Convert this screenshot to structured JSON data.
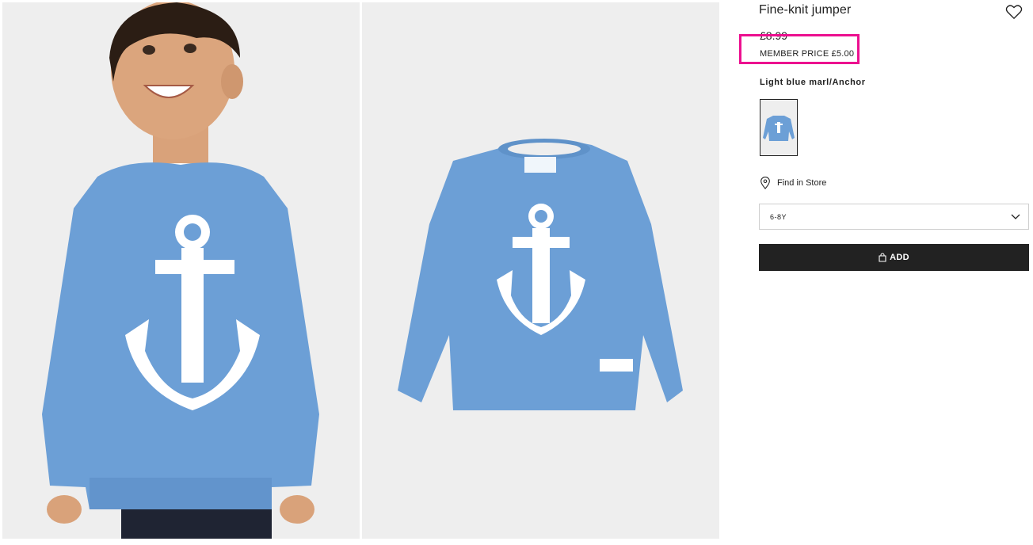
{
  "product": {
    "title": "Fine-knit jumper",
    "price_old": "£8.99",
    "member_price": "MEMBER PRICE £5.00",
    "color_name": "Light blue marl/Anchor"
  },
  "store": {
    "label": "Find in Store"
  },
  "size": {
    "selected": "6-8Y"
  },
  "cart": {
    "add_label": "ADD"
  },
  "colors": {
    "sweater": "#6c9fd6",
    "background": "#eeeeee",
    "button": "#222222",
    "highlight": "#ec0f8f"
  },
  "icons": [
    "heart-icon",
    "location-pin-icon",
    "chevron-down-icon",
    "shopping-bag-icon"
  ]
}
